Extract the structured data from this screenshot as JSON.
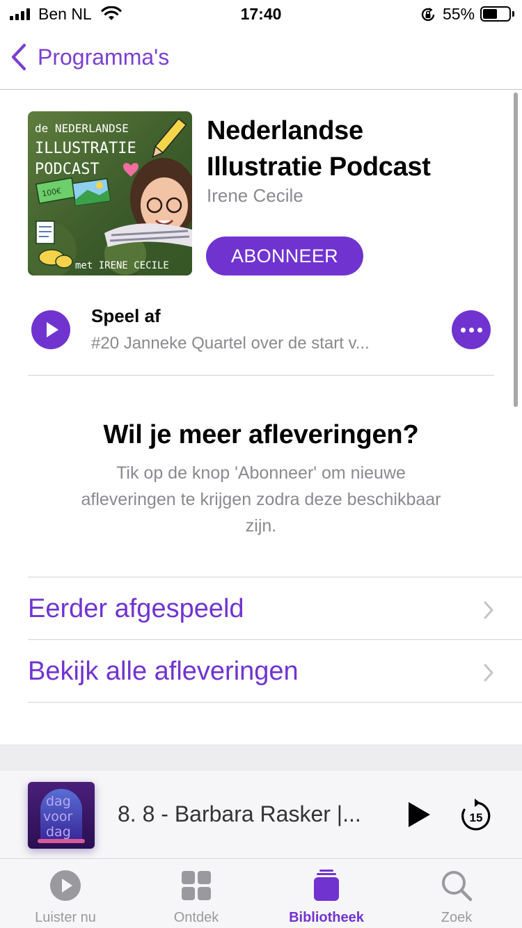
{
  "status_bar": {
    "carrier": "Ben NL",
    "time": "17:40",
    "battery_percent": "55%",
    "battery_level": 0.55
  },
  "nav": {
    "back_label": "Programma's"
  },
  "podcast": {
    "artwork": {
      "line1": "de NEDERLANDSE",
      "line2": "ILLUSTRATIE",
      "line3": "PODCAST",
      "note": "100€",
      "footer": "met IRENE CECILE"
    },
    "title_line1": "Nederlandse",
    "title_line2": "Illustratie Podcast",
    "author": "Irene Cecile",
    "subscribe_label": "ABONNEER"
  },
  "play_row": {
    "title": "Speel af",
    "episode": "#20 Janneke Quartel over de start v..."
  },
  "info": {
    "title": "Wil je meer afleveringen?",
    "text": "Tik op de knop 'Abonneer' om nieuwe afleveringen te krijgen zodra deze beschikbaar zijn."
  },
  "list": {
    "items": [
      {
        "label": "Eerder afgespeeld"
      },
      {
        "label": "Bekijk alle afleveringen"
      }
    ]
  },
  "mini_player": {
    "artwork_text1": "dag",
    "artwork_text2": "voor",
    "artwork_text3": "dag",
    "title": "8. 8 - Barbara Rasker |...",
    "skip_seconds": "15"
  },
  "tabs": [
    {
      "label": "Luister nu",
      "icon": "play-circle-icon"
    },
    {
      "label": "Ontdek",
      "icon": "grid-icon"
    },
    {
      "label": "Bibliotheek",
      "icon": "library-stack-icon",
      "active": true
    },
    {
      "label": "Zoek",
      "icon": "search-icon"
    }
  ],
  "colors": {
    "accent": "#7133d0",
    "secondary_text": "#8a8a8e"
  }
}
